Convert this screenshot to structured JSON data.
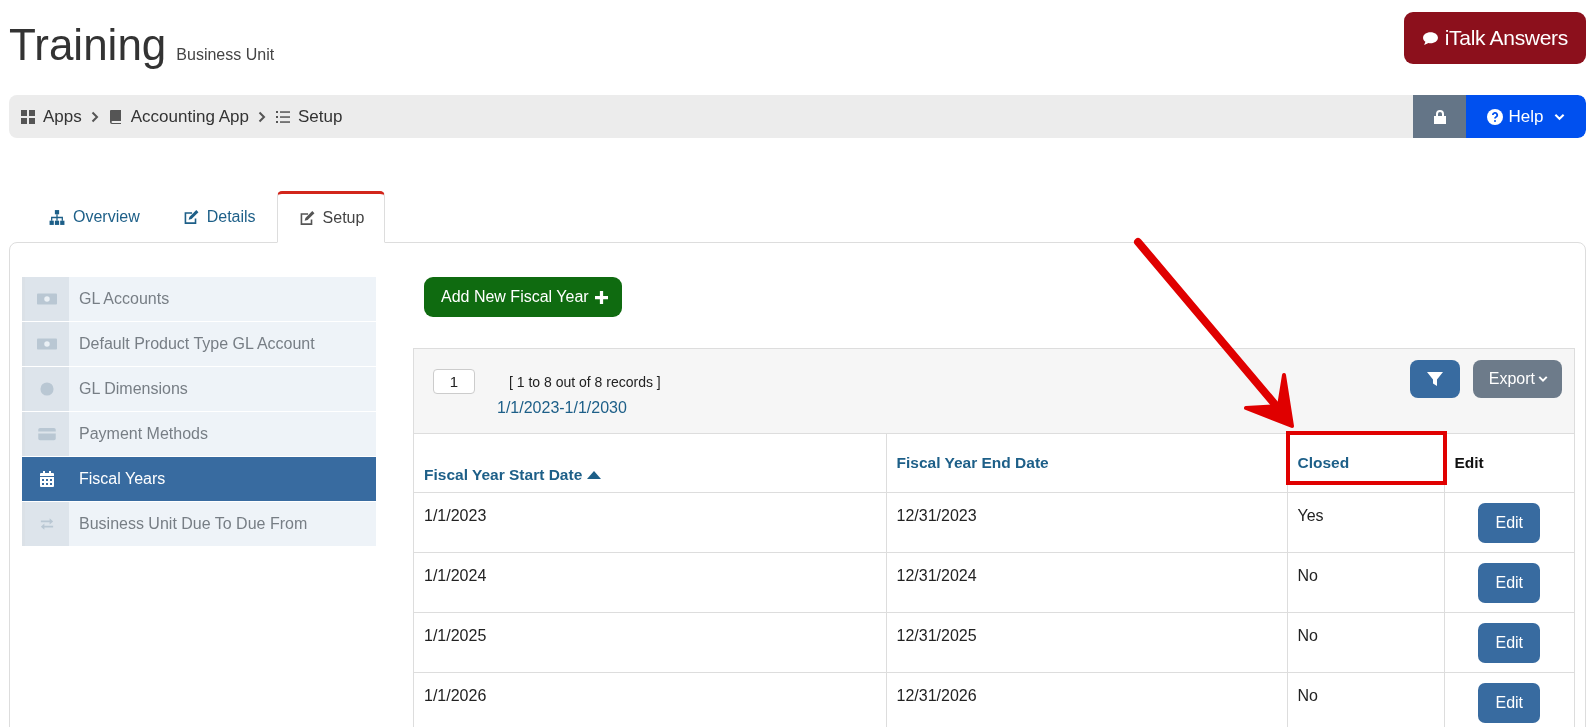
{
  "header": {
    "title": "Training",
    "subtitle": "Business Unit",
    "italk_button": "iTalk Answers"
  },
  "breadcrumb": [
    {
      "label": "Apps"
    },
    {
      "label": "Accounting App"
    },
    {
      "label": "Setup"
    }
  ],
  "help_button": "Help",
  "tabs": [
    {
      "label": "Overview",
      "selected": false
    },
    {
      "label": "Details",
      "selected": false
    },
    {
      "label": "Setup",
      "selected": true
    }
  ],
  "sidebar": {
    "items": [
      {
        "label": "GL Accounts",
        "selected": false
      },
      {
        "label": "Default Product Type GL Account",
        "selected": false
      },
      {
        "label": "GL Dimensions",
        "selected": false
      },
      {
        "label": "Payment Methods",
        "selected": false
      },
      {
        "label": "Fiscal Years",
        "selected": true
      },
      {
        "label": "Business Unit Due To Due From",
        "selected": false
      }
    ]
  },
  "add_button": "Add New Fiscal Year",
  "table": {
    "page": "1",
    "record_summary": "[ 1 to 8 out of 8 records ]",
    "date_range": "1/1/2023-1/1/2030",
    "export_button": "Export",
    "columns": [
      {
        "label": "Fiscal Year Start Date",
        "sorted": true,
        "highlighted": false
      },
      {
        "label": "Fiscal Year End Date",
        "sorted": false,
        "highlighted": false
      },
      {
        "label": "Closed",
        "sorted": false,
        "highlighted": true
      },
      {
        "label": "Edit",
        "sorted": false,
        "highlighted": false
      }
    ],
    "rows": [
      {
        "start": "1/1/2023",
        "end": "12/31/2023",
        "closed": "Yes",
        "edit": "Edit"
      },
      {
        "start": "1/1/2024",
        "end": "12/31/2024",
        "closed": "No",
        "edit": "Edit"
      },
      {
        "start": "1/1/2025",
        "end": "12/31/2025",
        "closed": "No",
        "edit": "Edit"
      },
      {
        "start": "1/1/2026",
        "end": "12/31/2026",
        "closed": "No",
        "edit": "Edit"
      }
    ]
  }
}
